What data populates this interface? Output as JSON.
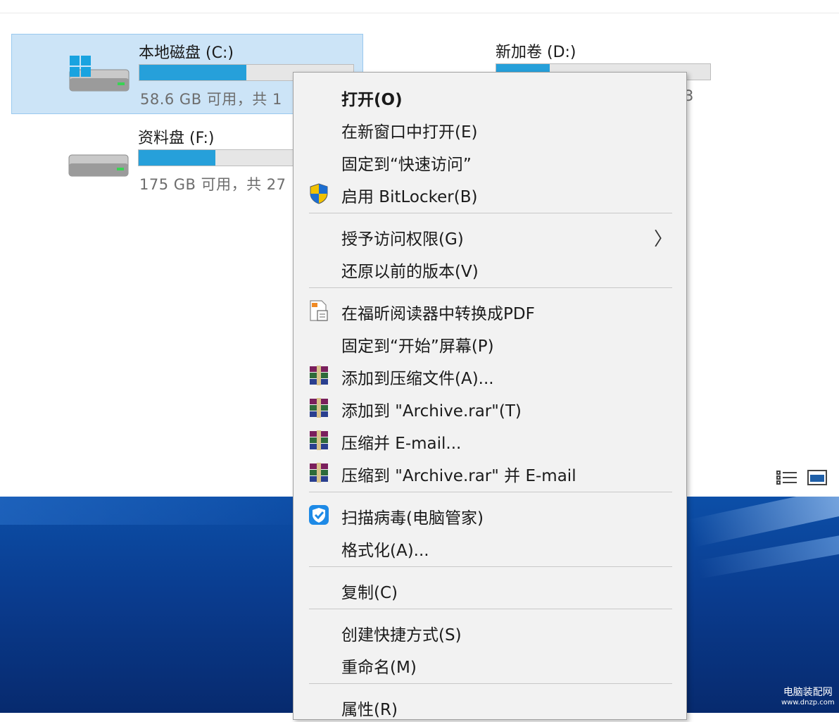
{
  "drives": [
    {
      "name": "本地磁盘 (C:)",
      "size_text": "58.6 GB 可用，共 1",
      "used_fraction": 0.5,
      "selected": true
    },
    {
      "name": "新加卷 (D:)",
      "size_text": "",
      "used_fraction": 0.25,
      "selected": false
    },
    {
      "name": "资料盘 (F:)",
      "size_text": "175 GB 可用，共 27",
      "used_fraction": 0.36,
      "selected": false
    }
  ],
  "partial_text_d": "3",
  "menu": {
    "items": [
      {
        "label": "打开(O)",
        "bold": true,
        "icon": ""
      },
      {
        "label": "在新窗口中打开(E)",
        "icon": ""
      },
      {
        "label": "固定到“快速访问”",
        "icon": ""
      },
      {
        "label": "启用 BitLocker(B)",
        "icon": "uac-shield-icon"
      },
      {
        "label": "授予访问权限(G)",
        "icon": "",
        "submenu": true
      },
      {
        "label": "还原以前的版本(V)",
        "icon": ""
      },
      {
        "label": "在福昕阅读器中转换成PDF",
        "icon": "foxit-pdf-icon"
      },
      {
        "label": "固定到“开始”屏幕(P)",
        "icon": ""
      },
      {
        "label": "添加到压缩文件(A)...",
        "icon": "winrar-icon"
      },
      {
        "label": "添加到 \"Archive.rar\"(T)",
        "icon": "winrar-icon"
      },
      {
        "label": "压缩并 E-mail...",
        "icon": "winrar-icon"
      },
      {
        "label": "压缩到 \"Archive.rar\" 并 E-mail",
        "icon": "winrar-icon"
      },
      {
        "label": "扫描病毒(电脑管家)",
        "icon": "tencent-guard-icon"
      },
      {
        "label": "格式化(A)...",
        "icon": ""
      },
      {
        "label": "复制(C)",
        "icon": ""
      },
      {
        "label": "创建快捷方式(S)",
        "icon": ""
      },
      {
        "label": "重命名(M)",
        "icon": ""
      },
      {
        "label": "属性(R)",
        "icon": ""
      }
    ],
    "submenu_arrow": "〉"
  },
  "watermark": {
    "line1": "电脑装配网",
    "line2": "www.dnzp.com"
  },
  "colors": {
    "selection": "#cce4f7",
    "bar_fill": "#26a0da",
    "desktop": "#0a3c8f"
  }
}
